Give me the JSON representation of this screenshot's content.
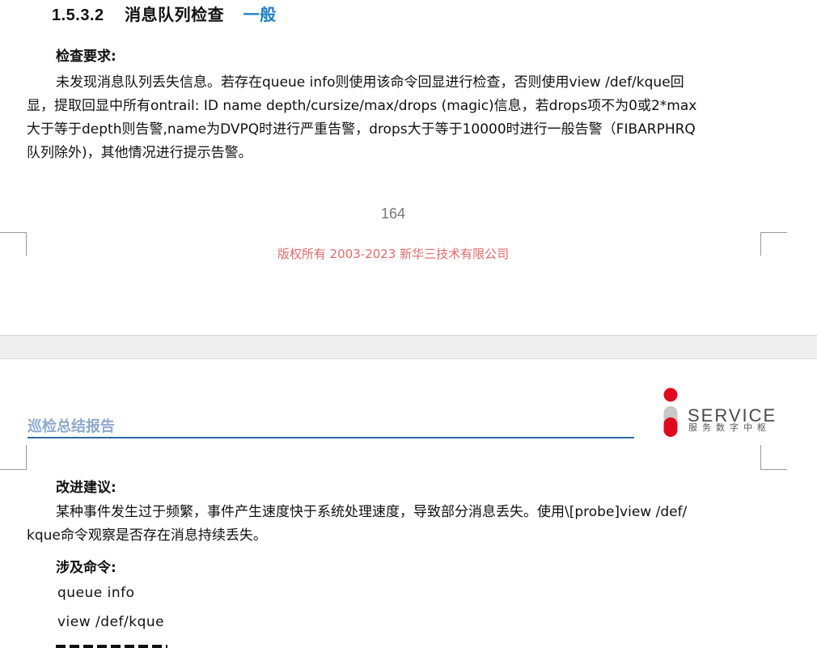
{
  "top_page": {
    "section_number": "1.5.3.2",
    "section_title": "消息队列检查",
    "section_level": "一般",
    "requirement_label": "检查要求:",
    "requirement_lines": [
      "未发现消息队列丢失信息。若存在queue info则使用该命令回显进行检查，否则使用view /def/kque回",
      "显，提取回显中所有ontrail: ID name depth/cursize/max/drops (magic)信息，若drops项不为0或2*max",
      "大于等于depth则告警,name为DVPQ时进行严重告警，drops大于等于10000时进行一般告警（FIBARPHRQ",
      "队列除外)，其他情况进行提示告警。"
    ],
    "page_number": "164",
    "footer": "版权所有 2003-2023 新华三技术有限公司"
  },
  "bottom_page": {
    "report_title": "巡检总结报告",
    "logo": {
      "text": "SERVICE",
      "subtitle": "服务数字中枢"
    },
    "suggestion_label": "改进建议:",
    "suggestion_lines": [
      "某种事件发生过于频繁，事件产生速度快于系统处理速度，导致部分消息丢失。使用\\[probe]view /def/",
      "kque命令观察是否存在消息持续丢失。"
    ],
    "commands_label": "涉及命令:",
    "commands": [
      "queue info",
      "view /def/kque"
    ]
  },
  "colors": {
    "level_accent": "#1f7fc4",
    "footer_text": "#e36a6a",
    "report_title": "#8ea9cf",
    "report_rule": "#2f6aa3",
    "logo_red": "#e00a1e",
    "logo_gray": "#c8c8c8"
  }
}
